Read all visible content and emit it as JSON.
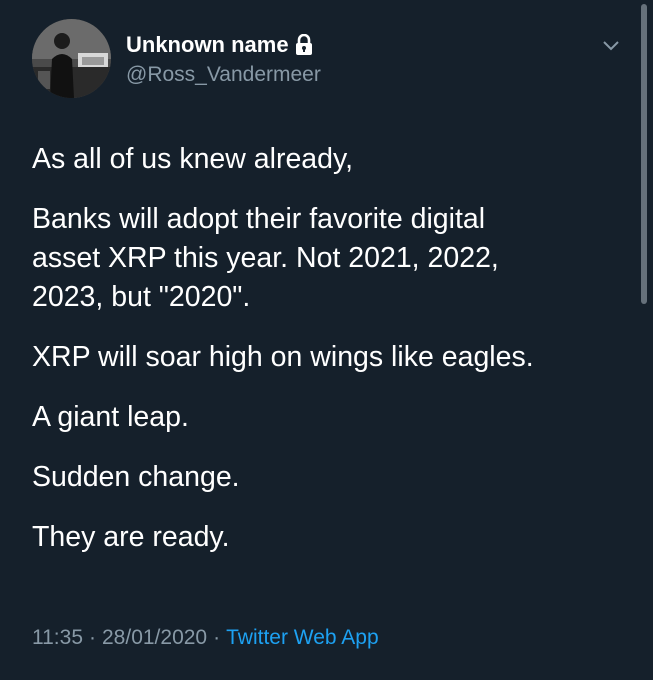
{
  "user": {
    "display_name": "Unknown name",
    "handle": "@Ross_Vandermeer",
    "protected_icon": "lock-icon",
    "avatar_icon": "profile-photo"
  },
  "tweet": {
    "paragraphs": [
      "As all of us knew already,",
      "Banks will adopt their favorite digital",
      "asset XRP this year. Not 2021, 2022,",
      "2023, but \"2020\".",
      "XRP will soar high on wings like eagles.",
      "A giant leap.",
      "Sudden change.",
      "They are ready."
    ],
    "time": "11:35",
    "date": "28/01/2020",
    "separator": "·",
    "source": "Twitter Web App"
  },
  "menu": {
    "icon": "chevron-down-icon"
  },
  "colors": {
    "background": "#15202b",
    "text": "#ffffff",
    "secondary": "#8899a6",
    "link": "#1da1f2"
  }
}
